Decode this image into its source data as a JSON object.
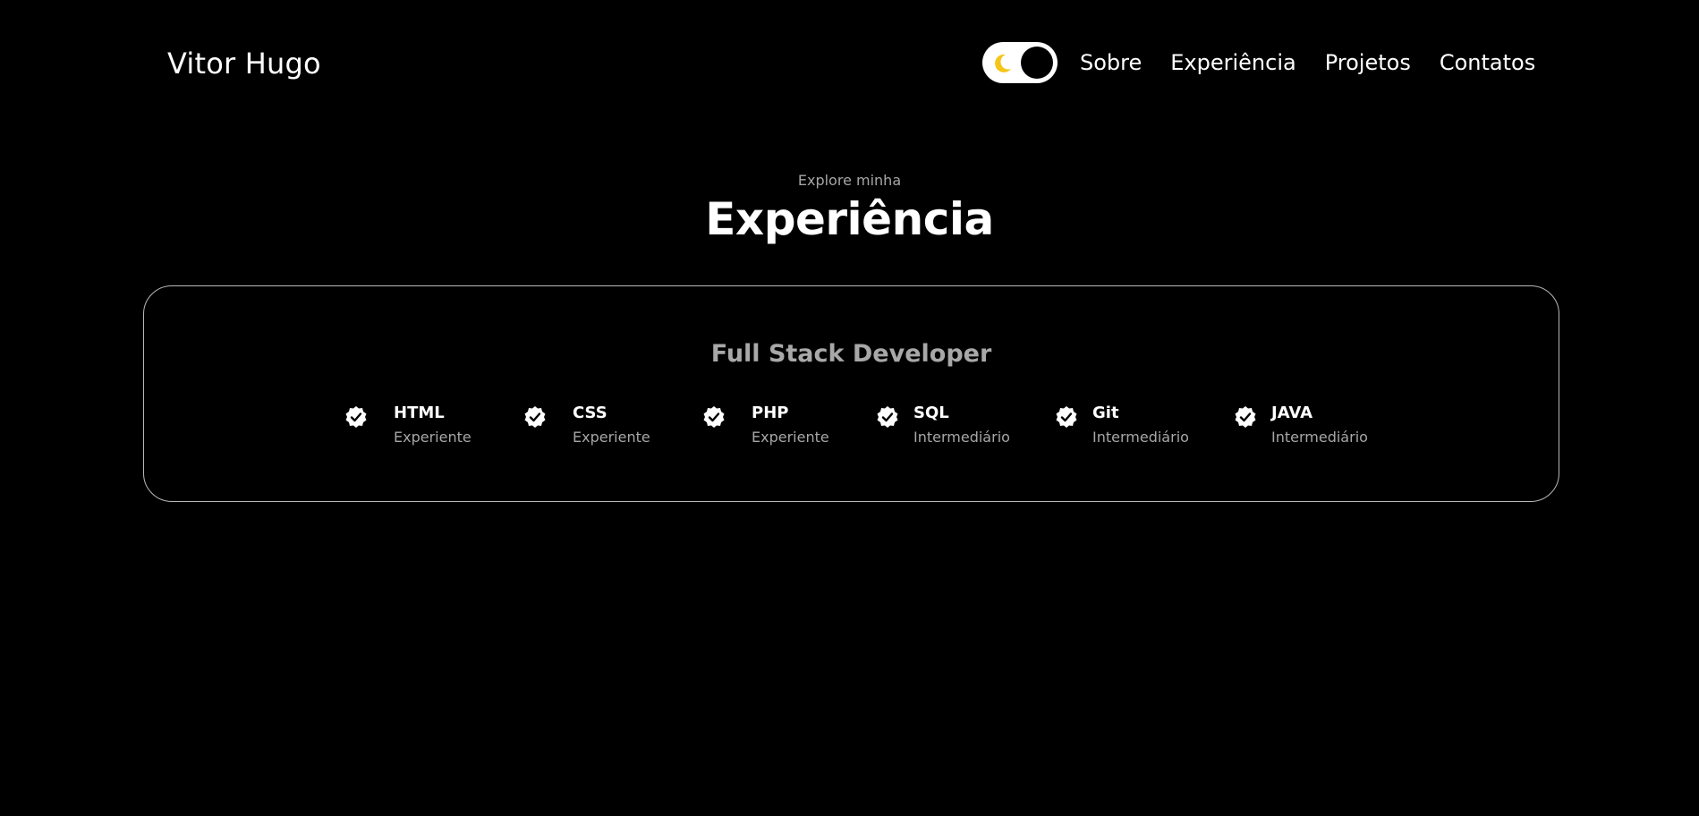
{
  "header": {
    "logo": "Vitor Hugo",
    "theme_toggle": {
      "state": "dark",
      "accent": "#f5c518"
    },
    "nav": [
      {
        "label": "Sobre"
      },
      {
        "label": "Experiência"
      },
      {
        "label": "Projetos"
      },
      {
        "label": "Contatos"
      }
    ]
  },
  "section": {
    "subtitle": "Explore minha",
    "title": "Experiência"
  },
  "card": {
    "title": "Full Stack Developer",
    "skills": [
      {
        "name": "HTML",
        "level": "Experiente",
        "icon": "check-badge-icon"
      },
      {
        "name": "CSS",
        "level": "Experiente",
        "icon": "check-badge-icon"
      },
      {
        "name": "PHP",
        "level": "Experiente",
        "icon": "check-badge-icon"
      },
      {
        "name": "SQL",
        "level": "Intermediário",
        "icon": "check-badge-icon"
      },
      {
        "name": "Git",
        "level": "Intermediário",
        "icon": "check-badge-icon"
      },
      {
        "name": "JAVA",
        "level": "Intermediário",
        "icon": "check-badge-icon"
      }
    ]
  },
  "colors": {
    "background": "#000000",
    "text": "#ffffff",
    "muted": "#a6a6a6",
    "border": "#b8b8b8"
  }
}
